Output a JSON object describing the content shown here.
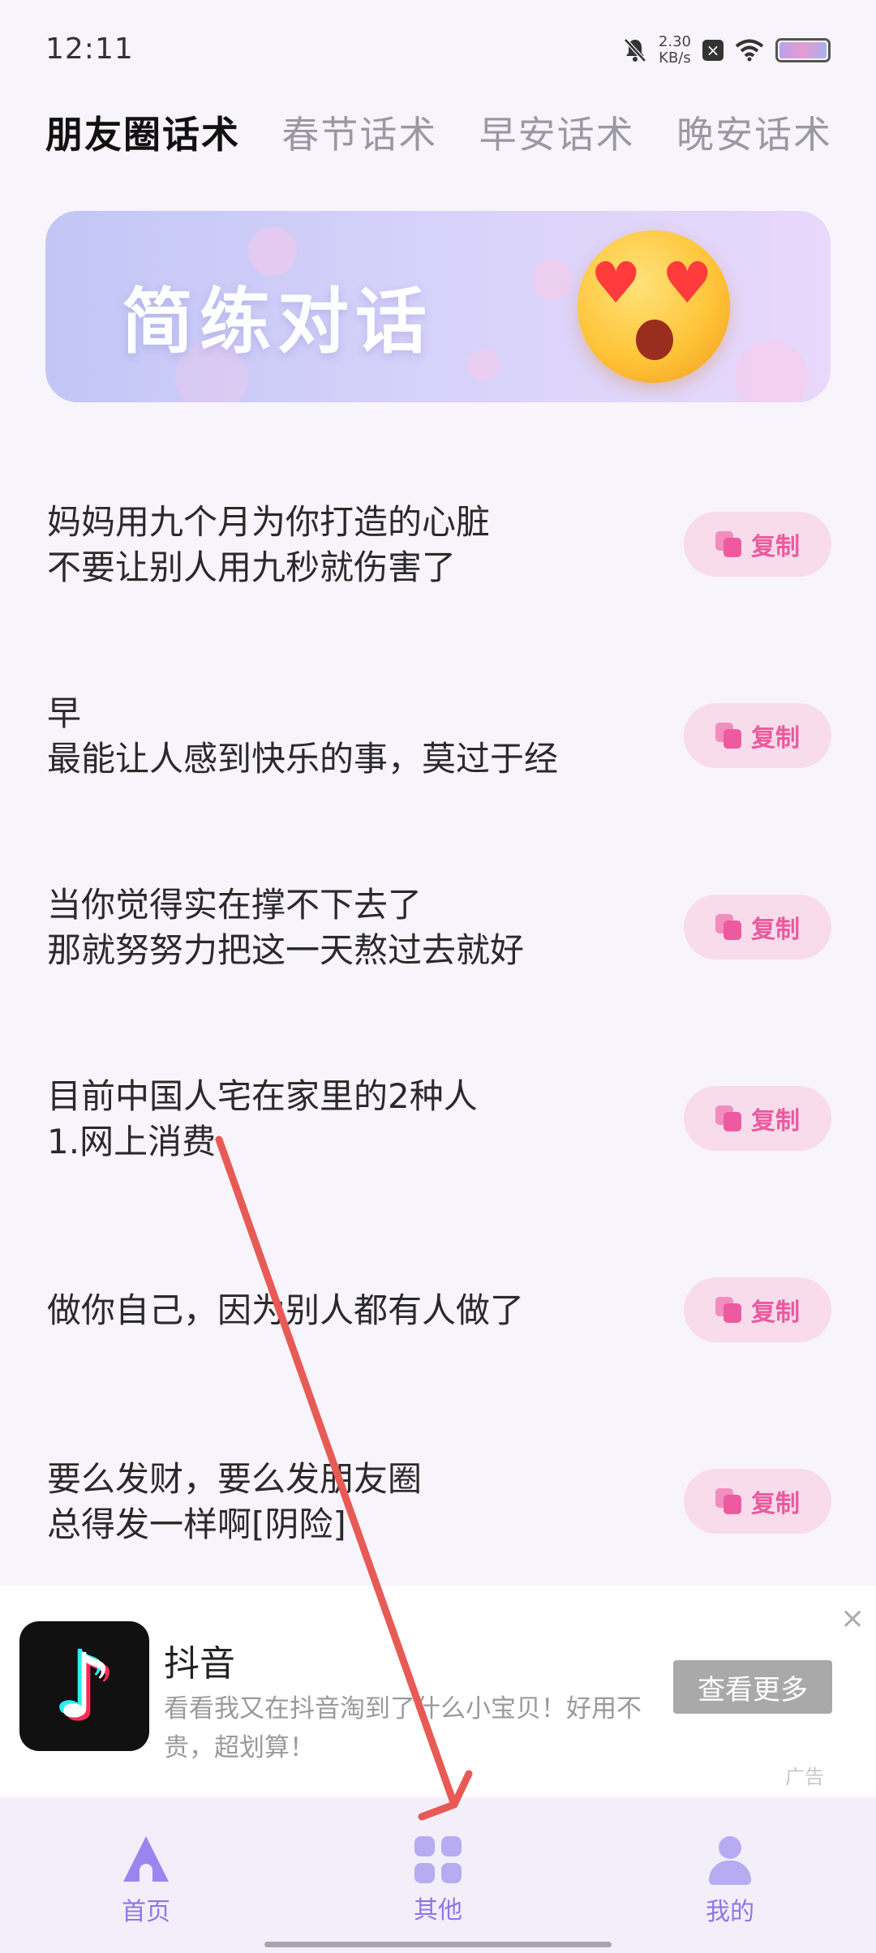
{
  "status_bar": {
    "time": "12:11",
    "net_speed_value": "2.30",
    "net_speed_unit": "KB/s"
  },
  "tabs": [
    {
      "label": "朋友圈话术",
      "active": true
    },
    {
      "label": "春节话术",
      "active": false
    },
    {
      "label": "早安话术",
      "active": false
    },
    {
      "label": "晚安话术",
      "active": false
    }
  ],
  "banner": {
    "title": "简练对话"
  },
  "list": {
    "copy_label": "复制",
    "items": [
      {
        "text": "妈妈用九个月为你打造的心脏\n不要让别人用九秒就伤害了"
      },
      {
        "text": "早\n最能让人感到快乐的事，莫过于经"
      },
      {
        "text": "当你觉得实在撑不下去了\n那就努努力把这一天熬过去就好"
      },
      {
        "text": "目前中国人宅在家里的2种人\n1.网上消费"
      },
      {
        "text": "做你自己，因为别人都有人做了"
      },
      {
        "text": "要么发财，要么发朋友圈\n总得发一样啊[阴险]"
      }
    ]
  },
  "ad": {
    "title": "抖音",
    "description": "看看我又在抖音淘到了什么小宝贝！好用不贵，超划算！",
    "cta": "查看更多",
    "tag": "广告",
    "close": "×"
  },
  "bottom_nav": [
    {
      "label": "首页",
      "icon": "home-icon"
    },
    {
      "label": "其他",
      "icon": "grid-icon"
    },
    {
      "label": "我的",
      "icon": "user-icon"
    }
  ],
  "colors": {
    "accent": "#8a78e6",
    "copy_button_bg": "#f8dcec",
    "copy_button_text": "#ea5a9e",
    "annotation_arrow": "#e85a55"
  }
}
